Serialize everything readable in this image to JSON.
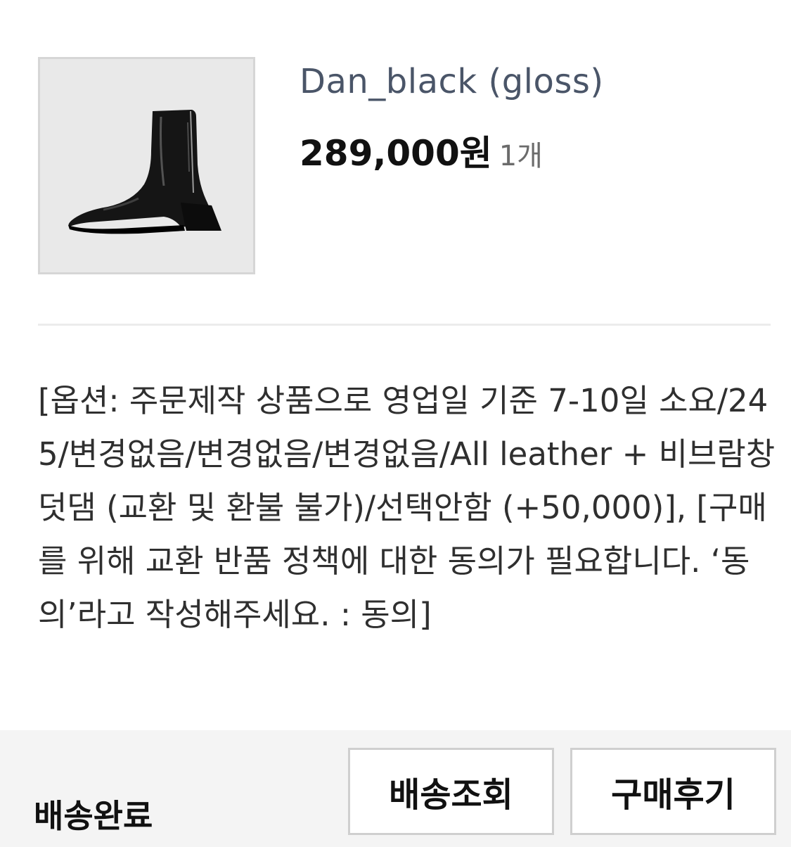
{
  "product": {
    "name": "Dan_black (gloss)",
    "price": "289,000원",
    "quantity": "1개",
    "image_icon": "ankle-boot-image"
  },
  "order_options": "[옵션: 주문제작 상품으로 영업일 기준 7-10일 소요/245/변경없음/변경없음/변경없음/All leather + 비브람창 덧댐 (교환 및 환불 불가)/선택안함 (+50,000)], [구매를 위해 교환 반품 정책에 대한 동의가 필요합니다. ‘동의’라고 작성해주세요. : 동의]",
  "footer": {
    "status": "배송완료",
    "track_button": "배송조회",
    "review_button": "구매후기"
  }
}
